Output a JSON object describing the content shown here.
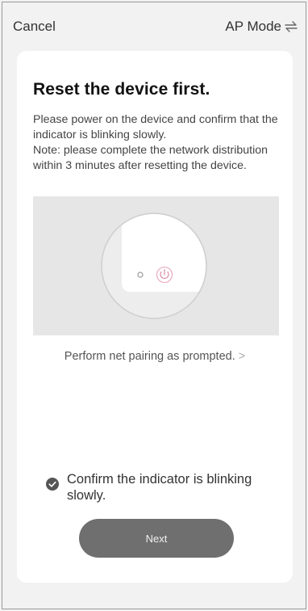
{
  "header": {
    "cancel_label": "Cancel",
    "mode_label": "AP Mode",
    "mode_icon": "swap-arrows-icon"
  },
  "main": {
    "title": "Reset the device first.",
    "description_lines": [
      "Please power on the device and confirm that the indicator is blinking slowly.",
      "Note: please complete the network distribution within 3 minutes after resetting the device."
    ],
    "illustration_icon": "power-icon",
    "pairing_link": "Perform net pairing as prompted.",
    "pairing_chevron": ">",
    "confirm_label": "Confirm the indicator is blinking slowly.",
    "confirm_checked": true,
    "next_label": "Next"
  },
  "colors": {
    "background": "#f2f2f2",
    "card": "#ffffff",
    "illustration_bg": "#e6e6e6",
    "button": "#6f6f6f",
    "text": "#222222"
  }
}
